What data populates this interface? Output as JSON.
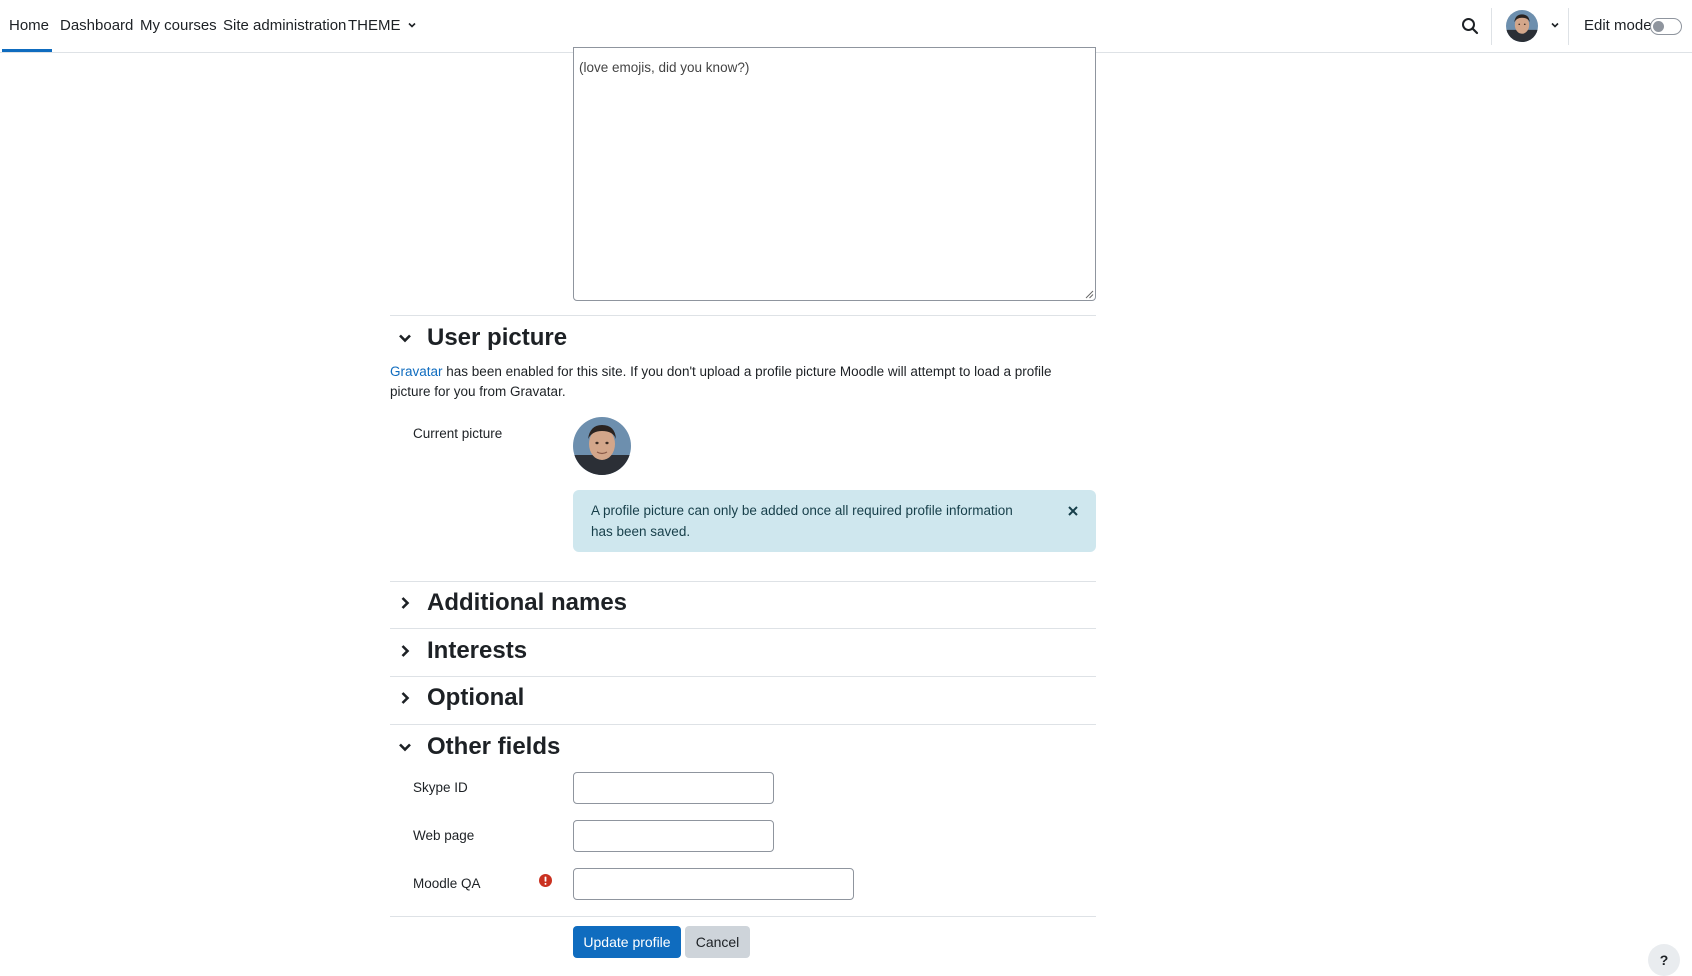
{
  "nav": {
    "home": "Home",
    "dashboard": "Dashboard",
    "my_courses": "My courses",
    "site_admin": "Site administration",
    "theme": "THEME",
    "edit_mode": "Edit mode"
  },
  "description": {
    "value": "(love emojis, did you know?)"
  },
  "sections": {
    "user_picture": "User picture",
    "additional_names": "Additional names",
    "interests": "Interests",
    "optional": "Optional",
    "other_fields": "Other fields"
  },
  "gravatar": {
    "link": "Gravatar",
    "text": " has been enabled for this site. If you don't upload a profile picture Moodle will attempt to load a profile picture for you from Gravatar."
  },
  "current_picture": {
    "label": "Current picture"
  },
  "alert": {
    "message": "A profile picture can only be added once all required profile information has been saved."
  },
  "fields": {
    "skype": {
      "label": "Skype ID",
      "value": ""
    },
    "webpage": {
      "label": "Web page",
      "value": ""
    },
    "moodle_qa": {
      "label": "Moodle QA",
      "value": ""
    }
  },
  "buttons": {
    "update": "Update profile",
    "cancel": "Cancel",
    "help": "?"
  },
  "colors": {
    "primary": "#0f6cbf",
    "alert_bg": "#cfe7ee",
    "required": "#ca3120"
  }
}
